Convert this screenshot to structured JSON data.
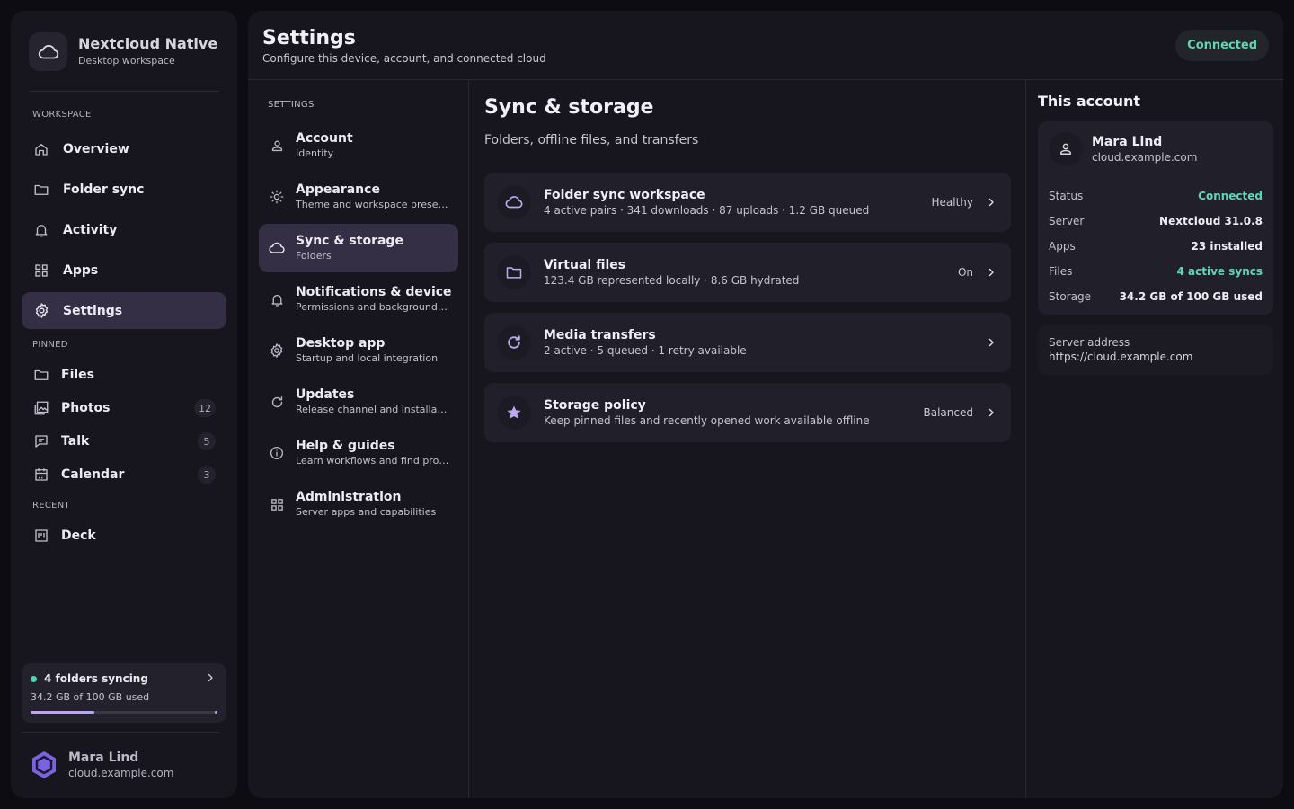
{
  "brand": {
    "name": "Nextcloud Native",
    "subtitle": "Desktop workspace"
  },
  "sidebar": {
    "workspace_label": "WORKSPACE",
    "workspace": [
      {
        "label": "Overview",
        "icon": "home-icon"
      },
      {
        "label": "Folder sync",
        "icon": "folder-icon"
      },
      {
        "label": "Activity",
        "icon": "bell-icon"
      },
      {
        "label": "Apps",
        "icon": "grid-icon"
      },
      {
        "label": "Settings",
        "icon": "gear-icon",
        "active": true
      }
    ],
    "pinned_label": "PINNED",
    "pinned": [
      {
        "label": "Files",
        "icon": "folder-icon"
      },
      {
        "label": "Photos",
        "icon": "image-icon",
        "count": "12"
      },
      {
        "label": "Talk",
        "icon": "chat-icon",
        "count": "5"
      },
      {
        "label": "Calendar",
        "icon": "calendar-icon",
        "count": "3"
      }
    ],
    "recent_label": "RECENT",
    "recent": [
      {
        "label": "Deck",
        "icon": "board-icon"
      }
    ],
    "sync": {
      "title": "4 folders syncing",
      "detail": "34.2 GB of 100 GB used",
      "progress": 0.342
    },
    "user": {
      "name": "Mara Lind",
      "host": "cloud.example.com"
    }
  },
  "header": {
    "title": "Settings",
    "subtitle": "Configure this device, account, and connected cloud",
    "status": "Connected"
  },
  "settings_menu": {
    "label": "SETTINGS",
    "items": [
      {
        "title": "Account",
        "desc": "Identity",
        "icon": "user-icon"
      },
      {
        "title": "Appearance",
        "desc": "Theme and workspace presentation",
        "icon": "sun-icon"
      },
      {
        "title": "Sync & storage",
        "desc": "Folders",
        "icon": "cloud-icon",
        "active": true
      },
      {
        "title": "Notifications & device",
        "desc": "Permissions and background features",
        "icon": "bell-icon"
      },
      {
        "title": "Desktop app",
        "desc": "Startup and local integration",
        "icon": "gear-icon"
      },
      {
        "title": "Updates",
        "desc": "Release channel and installation",
        "icon": "refresh-icon"
      },
      {
        "title": "Help & guides",
        "desc": "Learn workflows and find projects",
        "icon": "info-icon"
      },
      {
        "title": "Administration",
        "desc": "Server apps and capabilities",
        "icon": "grid-icon"
      }
    ]
  },
  "content": {
    "title": "Sync & storage",
    "subtitle": "Folders, offline files, and transfers",
    "cards": [
      {
        "title": "Folder sync workspace",
        "desc": "4 active pairs · 341 downloads · 87 uploads · 1.2 GB queued",
        "status": "Healthy",
        "icon": "cloud-icon"
      },
      {
        "title": "Virtual files",
        "desc": "123.4 GB represented locally · 8.6 GB hydrated",
        "status": "On",
        "icon": "folder-icon"
      },
      {
        "title": "Media transfers",
        "desc": "2 active · 5 queued · 1 retry available",
        "status": "",
        "icon": "refresh-icon"
      },
      {
        "title": "Storage policy",
        "desc": "Keep pinned files and recently opened work available offline",
        "status": "Balanced",
        "icon": "star-icon"
      }
    ]
  },
  "account": {
    "heading": "This account",
    "name": "Mara Lind",
    "host": "cloud.example.com",
    "rows": [
      {
        "key": "Status",
        "value": "Connected",
        "accent": true
      },
      {
        "key": "Server",
        "value": "Nextcloud 31.0.8"
      },
      {
        "key": "Apps",
        "value": "23 installed"
      },
      {
        "key": "Files",
        "value": "4 active syncs",
        "accent": true
      },
      {
        "key": "Storage",
        "value": "34.2 GB of 100 GB used"
      }
    ],
    "server_address_label": "Server address",
    "server_address": "https://cloud.example.com"
  },
  "colors": {
    "accent": "#b8a4f0",
    "success": "#5fd6b6",
    "background": "#0d0c12",
    "panel": "#17161e"
  }
}
